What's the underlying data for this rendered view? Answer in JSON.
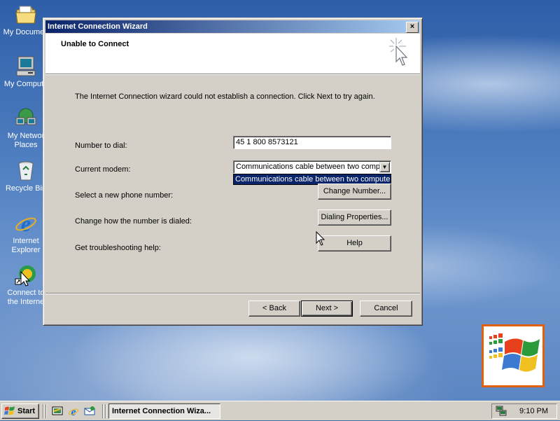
{
  "desktop": {
    "icons": [
      {
        "label": "My Documen",
        "icon": "folder-icon"
      },
      {
        "label": "My Compute",
        "icon": "computer-icon"
      },
      {
        "label": "My Networ\nPlaces",
        "icon": "network-icon"
      },
      {
        "label": "Recycle Bin",
        "icon": "recycle-bin-icon"
      },
      {
        "label": "Internet\nExplorer",
        "icon": "ie-icon"
      },
      {
        "label": "Connect to\nthe Interne",
        "icon": "connect-icon"
      }
    ]
  },
  "wizard": {
    "title": "Internet Connection Wizard",
    "close_label": "×",
    "header_title": "Unable to Connect",
    "message": "The Internet Connection wizard could not establish a connection. Click Next to try again.",
    "number_label": "Number to dial:",
    "number_value": "45  1 800 8573121",
    "modem_label": "Current modem:",
    "modem_value": "Communications cable between two compu",
    "modem_option": "Communications cable between two computers",
    "new_number_label": "Select a new phone number:",
    "change_number_button": "Change Number...",
    "dialing_label": "Change how the number is dialed:",
    "dialing_button": "Dialing Properties...",
    "help_label": "Get troubleshooting help:",
    "help_button": "Help",
    "back_button": "< Back",
    "next_button": "Next >",
    "cancel_button": "Cancel"
  },
  "taskbar": {
    "start_label": "Start",
    "task_item": "Internet Connection Wiza...",
    "clock": "9:10 PM"
  },
  "colors": {
    "title_gradient_start": "#0a246a",
    "title_gradient_end": "#a6caf0",
    "selection": "#0a246a",
    "logo_border": "#e0600c"
  }
}
